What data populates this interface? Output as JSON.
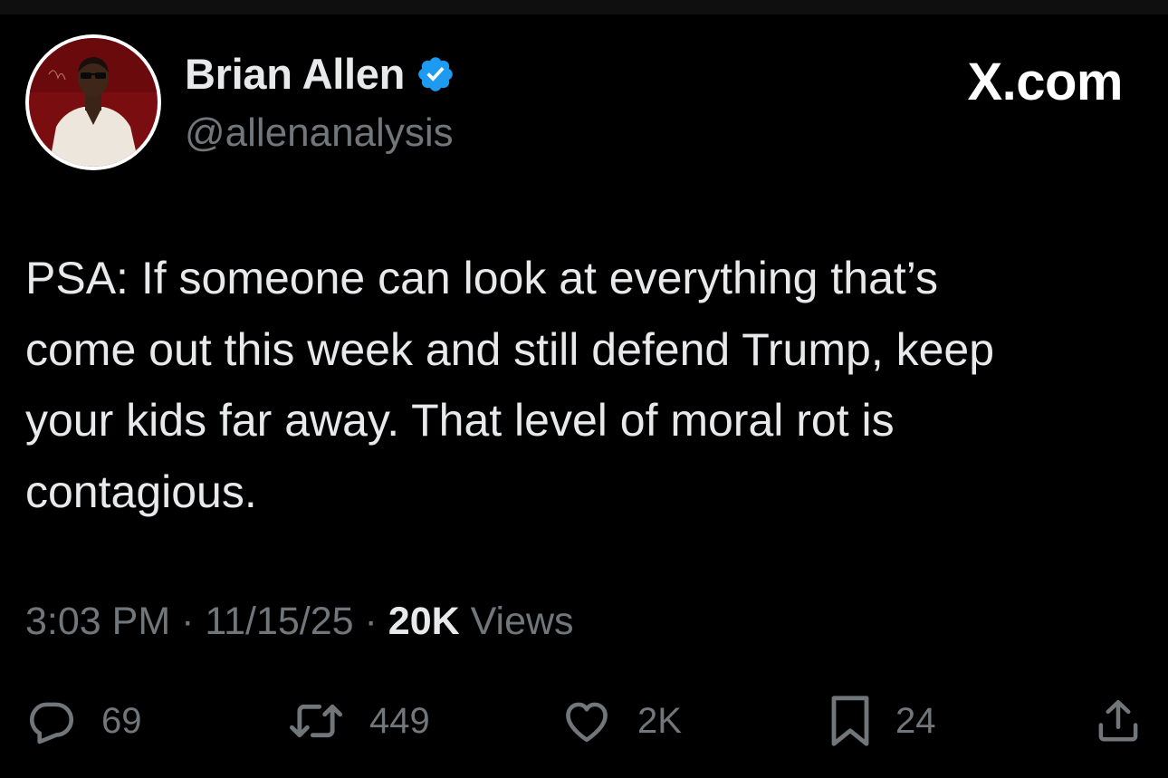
{
  "author": {
    "name": "Brian Allen",
    "handle": "@allenanalysis",
    "verified": true,
    "avatar_icon": "profile-photo"
  },
  "brand": {
    "label": "X.com"
  },
  "tweet": {
    "text": "PSA: If someone can look at everything that’s\ncome out this week and still defend Trump, keep\nyour kids far away. That level of moral rot is\ncontagious."
  },
  "meta": {
    "time": "3:03 PM",
    "separator": " · ",
    "date": "11/15/25",
    "views_count": "20K",
    "views_label": " Views"
  },
  "actions": {
    "replies": "69",
    "reposts": "449",
    "likes": "2K",
    "bookmarks": "24"
  },
  "colors": {
    "background": "#000000",
    "text_primary": "#e7e9ea",
    "text_secondary": "#71767b",
    "verified_blue": "#1d9bf0"
  }
}
